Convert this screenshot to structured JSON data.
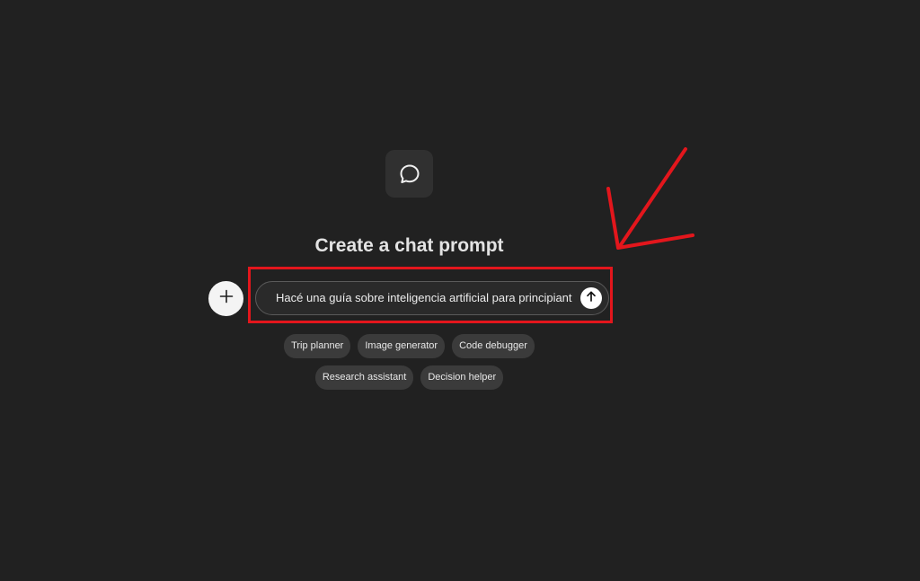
{
  "page": {
    "title": "Create a chat prompt"
  },
  "icons": {
    "app": "chat-bubble-icon",
    "attach": "plus-icon",
    "send": "arrow-up-icon",
    "annotation": "red-arrow-annotation"
  },
  "prompt": {
    "value": "Hacé una guía sobre inteligencia artificial para principiantes"
  },
  "suggestions": {
    "row1": [
      "Trip planner",
      "Image generator",
      "Code debugger"
    ],
    "row2": [
      "Research assistant",
      "Decision helper"
    ]
  },
  "colors": {
    "background": "#212121",
    "annotation": "#e3161c",
    "chip": "#3b3b3b"
  }
}
